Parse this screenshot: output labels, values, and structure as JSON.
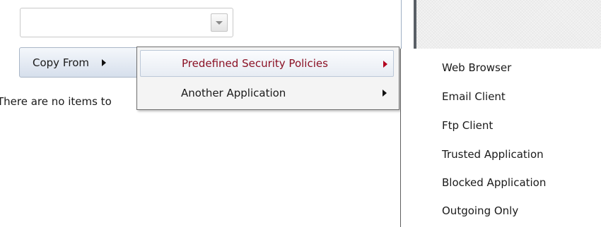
{
  "combo": {
    "value": ""
  },
  "copy_button": {
    "label": "Copy From"
  },
  "empty_message": "There are no items to",
  "copy_menu": {
    "items": [
      {
        "label": "Predefined Security Policies",
        "highlighted": true
      },
      {
        "label": "Another Application",
        "highlighted": false
      }
    ]
  },
  "policies_submenu": {
    "items": [
      {
        "label": "Web Browser"
      },
      {
        "label": "Email Client"
      },
      {
        "label": "Ftp Client"
      },
      {
        "label": "Trusted Application"
      },
      {
        "label": "Blocked Application"
      },
      {
        "label": "Outgoing Only"
      }
    ]
  },
  "colors": {
    "highlight_text": "#8a1024",
    "highlight_arrow": "#b3001f",
    "menu_border": "#6e6e6e"
  }
}
